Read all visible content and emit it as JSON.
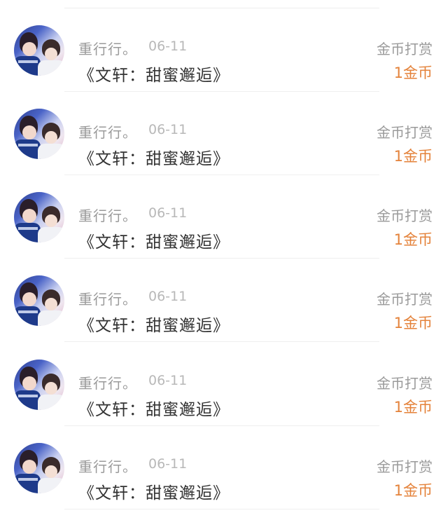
{
  "records": [
    {
      "user": "重行行。",
      "date": "06-11",
      "book": "《文轩：甜蜜邂逅》",
      "action": "金币打赏",
      "amount": "1金币"
    },
    {
      "user": "重行行。",
      "date": "06-11",
      "book": "《文轩：甜蜜邂逅》",
      "action": "金币打赏",
      "amount": "1金币"
    },
    {
      "user": "重行行。",
      "date": "06-11",
      "book": "《文轩：甜蜜邂逅》",
      "action": "金币打赏",
      "amount": "1金币"
    },
    {
      "user": "重行行。",
      "date": "06-11",
      "book": "《文轩：甜蜜邂逅》",
      "action": "金币打赏",
      "amount": "1金币"
    },
    {
      "user": "重行行。",
      "date": "06-11",
      "book": "《文轩：甜蜜邂逅》",
      "action": "金币打赏",
      "amount": "1金币"
    },
    {
      "user": "重行行。",
      "date": "06-11",
      "book": "《文轩：甜蜜邂逅》",
      "action": "金币打赏",
      "amount": "1金币"
    }
  ],
  "colors": {
    "amount": "#e4823a",
    "muted_text": "#9a9a9a",
    "primary_text": "#333333"
  }
}
